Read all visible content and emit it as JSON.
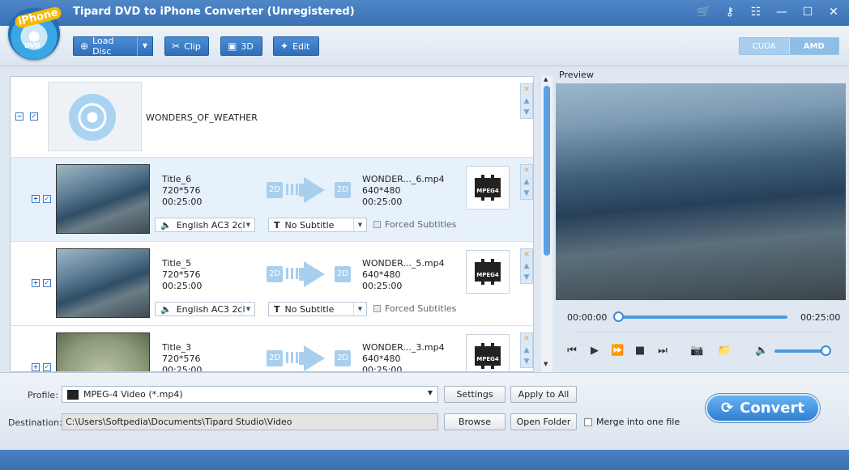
{
  "app": {
    "title": "Tipard DVD to iPhone Converter (Unregistered)",
    "logo_top": "iPhone",
    "logo_bottom": "DVD"
  },
  "titlebar_icons": [
    "cart-icon",
    "key-icon",
    "register-icon",
    "minimize-icon",
    "maximize-icon",
    "close-icon"
  ],
  "toolbar": {
    "load_disc": "Load Disc",
    "clip": "Clip",
    "threed": "3D",
    "edit": "Edit"
  },
  "gpu": {
    "cuda": "CUDA",
    "amd": "AMD"
  },
  "disc": {
    "title": "WONDERS_OF_WEATHER"
  },
  "titles": [
    {
      "name": "Title_6",
      "res": "720*576",
      "dur": "00:25:00",
      "out_name": "WONDER..._6.mp4",
      "out_res": "640*480",
      "out_dur": "00:25:00",
      "audio": "English AC3 2cl",
      "subtitle": "No Subtitle",
      "forced": "Forced Subtitles",
      "mode_in": "2D",
      "mode_out": "2D",
      "format": "MPEG4"
    },
    {
      "name": "Title_5",
      "res": "720*576",
      "dur": "00:25:00",
      "out_name": "WONDER..._5.mp4",
      "out_res": "640*480",
      "out_dur": "00:25:00",
      "audio": "English AC3 2cl",
      "subtitle": "No Subtitle",
      "forced": "Forced Subtitles",
      "mode_in": "2D",
      "mode_out": "2D",
      "format": "MPEG4"
    },
    {
      "name": "Title_3",
      "res": "720*576",
      "dur": "00:25:00",
      "out_name": "WONDER..._3.mp4",
      "out_res": "640*480",
      "out_dur": "00:25:00",
      "mode_in": "2D",
      "mode_out": "2D",
      "format": "MPEG4"
    }
  ],
  "preview": {
    "label": "Preview",
    "time_start": "00:00:00",
    "time_end": "00:25:00",
    "progress": 0.0,
    "volume": 0.9
  },
  "bottom": {
    "profile_label": "Profile:",
    "profile_value": "MPEG-4 Video (*.mp4)",
    "settings": "Settings",
    "apply_all": "Apply to All",
    "dest_label": "Destination:",
    "dest_value": "C:\\Users\\Softpedia\\Documents\\Tipard Studio\\Video",
    "browse": "Browse",
    "open_folder": "Open Folder",
    "merge": "Merge into one file",
    "convert": "Convert"
  }
}
